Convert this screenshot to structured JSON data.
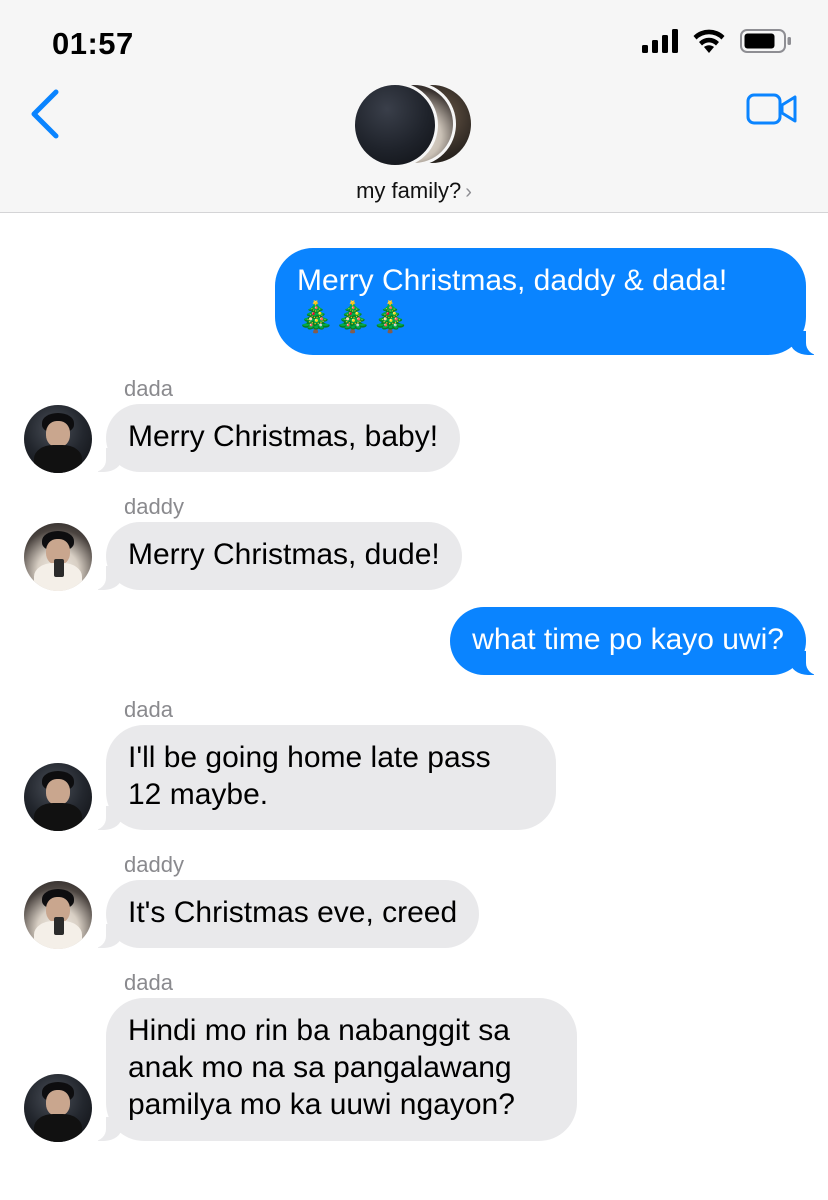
{
  "status_bar": {
    "time": "01:57"
  },
  "header": {
    "title": "my family?",
    "chevron": "›"
  },
  "icons": {
    "back": "chevron-left-icon",
    "video": "video-camera-icon",
    "signal": "cellular-signal-icon",
    "wifi": "wifi-icon",
    "battery": "battery-icon",
    "accent": "#0a84ff"
  },
  "messages": [
    {
      "direction": "out",
      "text_line1": "Merry Christmas, daddy & dada!",
      "text_line2": "🎄🎄🎄"
    },
    {
      "direction": "in",
      "sender": "dada",
      "text": "Merry Christmas, baby!"
    },
    {
      "direction": "in",
      "sender": "daddy",
      "text": "Merry Christmas, dude!"
    },
    {
      "direction": "out",
      "text": "what time po kayo uwi?"
    },
    {
      "direction": "in",
      "sender": "dada",
      "text_line1": "I'll be going home late pass",
      "text_line2": "12 maybe."
    },
    {
      "direction": "in",
      "sender": "daddy",
      "text": "It's Christmas eve, creed"
    },
    {
      "direction": "in",
      "sender": "dada",
      "text_line1": "Hindi mo rin ba nabanggit sa",
      "text_line2": "anak mo na sa pangalawang",
      "text_line3": "pamilya mo ka uuwi ngayon?"
    }
  ]
}
